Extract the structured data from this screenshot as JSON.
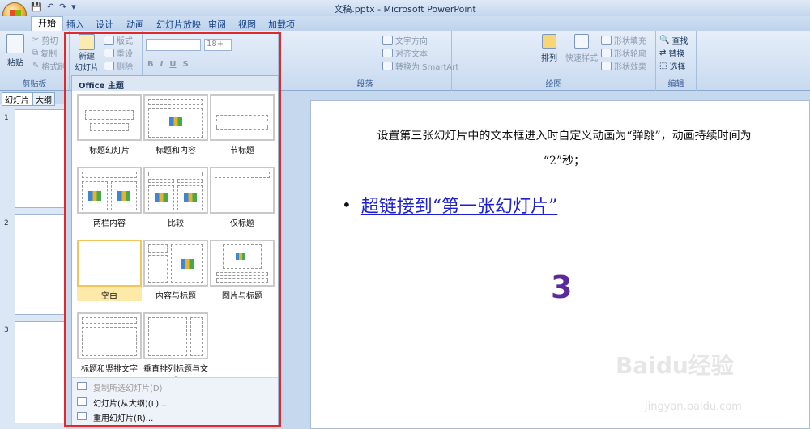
{
  "window": {
    "title": "文稿.pptx - Microsoft PowerPoint"
  },
  "qat": [
    "💾",
    "↶",
    "↷",
    "▾"
  ],
  "tabs": [
    "开始",
    "插入",
    "设计",
    "动画",
    "幻灯片放映",
    "审阅",
    "视图",
    "加载项"
  ],
  "ribbon": {
    "clipboard": {
      "paste": "粘贴",
      "cut": "剪切",
      "copy": "复制",
      "format_painter": "格式刷",
      "label": "剪贴板"
    },
    "slides": {
      "new_slide_1": "新建",
      "new_slide_2": "幻灯片",
      "layout": "版式",
      "reset": "重设",
      "delete": "删除"
    },
    "font": {
      "size": "18+"
    },
    "paragraph": {
      "text_direction": "文字方向",
      "align_text": "对齐文本",
      "smartart": "转换为 SmartArt",
      "label": "段落"
    },
    "drawing": {
      "arrange": "排列",
      "quick_styles": "快速样式",
      "shape_fill": "形状填充",
      "shape_outline": "形状轮廓",
      "shape_effects": "形状效果",
      "label": "绘图"
    },
    "editing": {
      "find": "查找",
      "replace": "替换",
      "select": "选择",
      "label": "编辑"
    }
  },
  "left_pane": {
    "tab_slides": "幻灯片",
    "tab_outline": "大纲",
    "thumb_nums": [
      "1",
      "2",
      "3"
    ]
  },
  "dropdown": {
    "header": "Office 主题",
    "layouts": [
      "标题幻灯片",
      "标题和内容",
      "节标题",
      "两栏内容",
      "比较",
      "仅标题",
      "空白",
      "内容与标题",
      "图片与标题",
      "标题和竖排文字",
      "垂直排列标题与文本"
    ],
    "footer": [
      "复制所选幻灯片(D)",
      "幻灯片(从大纲)(L)...",
      "重用幻灯片(R)..."
    ]
  },
  "slide": {
    "line1": "设置第三张幻灯片中的文本框进入时自定义动画为“弹跳”，动画持续时间为",
    "line2": "“2”秒；",
    "bullet": "•",
    "link": "超链接到“第一张幻灯片”",
    "number": "3"
  },
  "watermark": {
    "text": "Baidu经验",
    "sub": "jingyan.baidu.com"
  },
  "colors": {
    "accent": "#e02a2a",
    "link": "#1c1fd3",
    "number": "#5a2a9c"
  }
}
